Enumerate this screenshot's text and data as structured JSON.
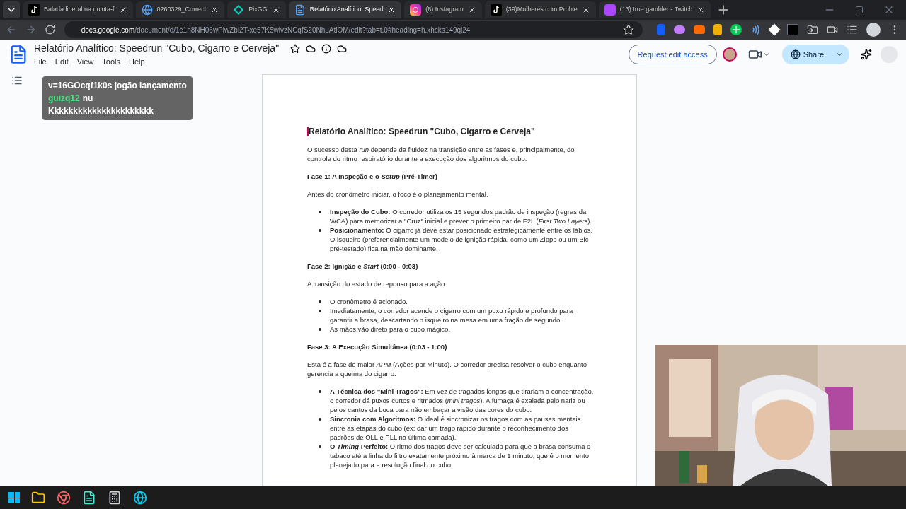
{
  "browser": {
    "tabs": [
      {
        "label": "Balada liberal na quinta-f",
        "kind": "tiktok",
        "selected": false
      },
      {
        "label": "0260329_Correct",
        "kind": "globe",
        "selected": false
      },
      {
        "label": "PixGG",
        "kind": "pix",
        "selected": false
      },
      {
        "label": "Relatório Analítico: Speed",
        "kind": "docs",
        "selected": true
      },
      {
        "label": "(8) Instagram",
        "kind": "instagram",
        "selected": false
      },
      {
        "label": "(39)Mulheres com Proble",
        "kind": "tiktok",
        "selected": false
      },
      {
        "label": "(13) true gambler - Twitch",
        "kind": "twitch",
        "selected": false
      }
    ],
    "url_host": "docs.google.com",
    "url_path": "/document/d/1c1h8NH06wPlwZbi2T-xe57K5wlvzNCqfS20NhuAtiOM/edit?tab=t.0#heading=h.xhcks149qi24"
  },
  "stream_overlay": {
    "link": "v=16GOcqf1k0s jogão lançamento",
    "chat": [
      {
        "user": "guizq12",
        "message": "nu"
      },
      {
        "message": "Kkkkkkkkkkkkkkkkkkkkkk"
      }
    ]
  },
  "doc": {
    "title": "Relatório Analítico: Speedrun \"Cubo, Cigarro e Cerveja\"",
    "menu": [
      "File",
      "Edit",
      "View",
      "Tools",
      "Help"
    ],
    "request_button": "Request edit access",
    "share_button": "Share"
  },
  "content": [
    {
      "kind": "title",
      "text": "Relatório Analítico: Speedrun \"Cubo, Cigarro e Cerveja\""
    },
    {
      "kind": "p",
      "text": "O sucesso desta *run* depende da fluidez na transição entre as fases e, principalmente, do controle do ritmo respiratório durante a execução dos algoritmos do cubo."
    },
    {
      "kind": "h",
      "text": "Fase 1: A Inspeção e o *Setup* (Pré-Timer)"
    },
    {
      "kind": "p",
      "text": "Antes do cronômetro iniciar, o foco é o planejamento mental."
    },
    {
      "kind": "list",
      "items": [
        "**Inspeção do Cubo:** O corredor utiliza os 15 segundos padrão de inspeção (regras da WCA) para memorizar a \"Cruz\" inicial e prever o primeiro par de F2L (*First Two Layers*).",
        "**Posicionamento:** O cigarro já deve estar posicionado estrategicamente entre os lábios. O isqueiro (preferencialmente um modelo de ignição rápida, como um Zippo ou um Bic pré-testado) fica na mão dominante."
      ]
    },
    {
      "kind": "h",
      "text": "Fase 2: Ignição e *Start* (0:00 - 0:03)"
    },
    {
      "kind": "p",
      "text": "A transição do estado de repouso para a ação."
    },
    {
      "kind": "list",
      "items": [
        "O cronômetro é acionado.",
        "Imediatamente, o corredor acende o cigarro com um puxo rápido e profundo para garantir a brasa, descartando o isqueiro na mesa em uma fração de segundo.",
        "As mãos vão direto para o cubo mágico."
      ]
    },
    {
      "kind": "h",
      "text": "Fase 3: A Execução Simultânea (0:03 - 1:00)"
    },
    {
      "kind": "p",
      "text": "Esta é a fase de maior *APM* (Ações por Minuto). O corredor precisa resolver o cubo enquanto gerencia a queima do cigarro."
    },
    {
      "kind": "list",
      "items": [
        "**A Técnica dos \"Mini Tragos\":** Em vez de tragadas longas que tirariam a concentração, o corredor dá puxos curtos e ritmados (*mini tragos*). A fumaça é exalada pelo nariz ou pelos cantos da boca para não embaçar a visão das cores do cubo.",
        "**Sincronia com Algoritmos:** O ideal é sincronizar os tragos com as pausas mentais entre as etapas do cubo (ex: dar um trago rápido durante o reconhecimento dos padrões de OLL e PLL na última camada).",
        "**O *Timing* Perfeito:** O ritmo dos tragos deve ser calculado para que a brasa consuma o tabaco até a linha do filtro exatamente próximo à marca de 1 minuto, que é o momento planejado para a resolução final do cubo."
      ]
    }
  ]
}
